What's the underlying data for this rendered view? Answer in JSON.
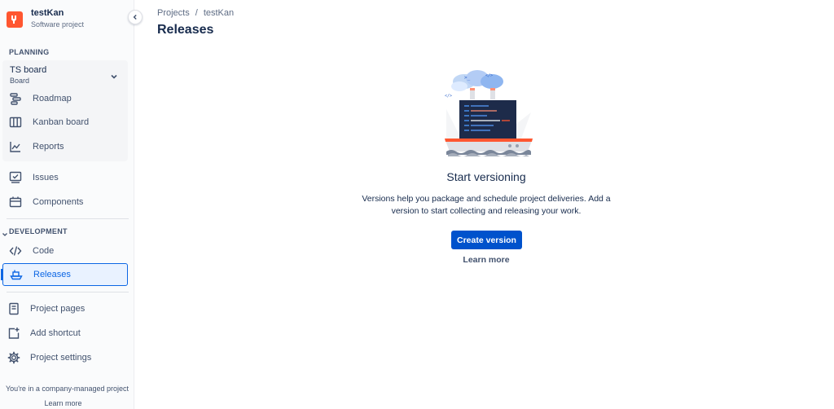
{
  "project": {
    "name": "testKan",
    "type": "Software project"
  },
  "sidebar": {
    "planning_label": "PLANNING",
    "board": {
      "name": "TS board",
      "sub": "Board"
    },
    "board_items": [
      {
        "label": "Roadmap",
        "icon": "roadmap-icon"
      },
      {
        "label": "Kanban board",
        "icon": "kanban-board-icon"
      },
      {
        "label": "Reports",
        "icon": "reports-icon"
      }
    ],
    "items": [
      {
        "label": "Issues",
        "icon": "issues-icon"
      },
      {
        "label": "Components",
        "icon": "components-icon"
      }
    ],
    "development_label": "DEVELOPMENT",
    "dev_items": [
      {
        "label": "Code",
        "icon": "code-icon"
      },
      {
        "label": "Releases",
        "icon": "ship-icon"
      }
    ],
    "bottom_items": [
      {
        "label": "Project pages",
        "icon": "page-icon"
      },
      {
        "label": "Add shortcut",
        "icon": "add-shortcut-icon"
      },
      {
        "label": "Project settings",
        "icon": "gear-icon"
      }
    ],
    "footer_note": "You're in a company-managed project",
    "footer_link": "Learn more"
  },
  "breadcrumb": {
    "projects": "Projects",
    "separator": "/",
    "project": "testKan"
  },
  "page": {
    "title": "Releases"
  },
  "empty_state": {
    "title": "Start versioning",
    "description": "Versions help you package and schedule project deliveries. Add a version to start collecting and releasing your work.",
    "create_button": "Create version",
    "learn_more": "Learn more"
  },
  "colors": {
    "primary": "#0052cc",
    "active_nav": "#0c66e4",
    "project_avatar": "#ff5630"
  }
}
